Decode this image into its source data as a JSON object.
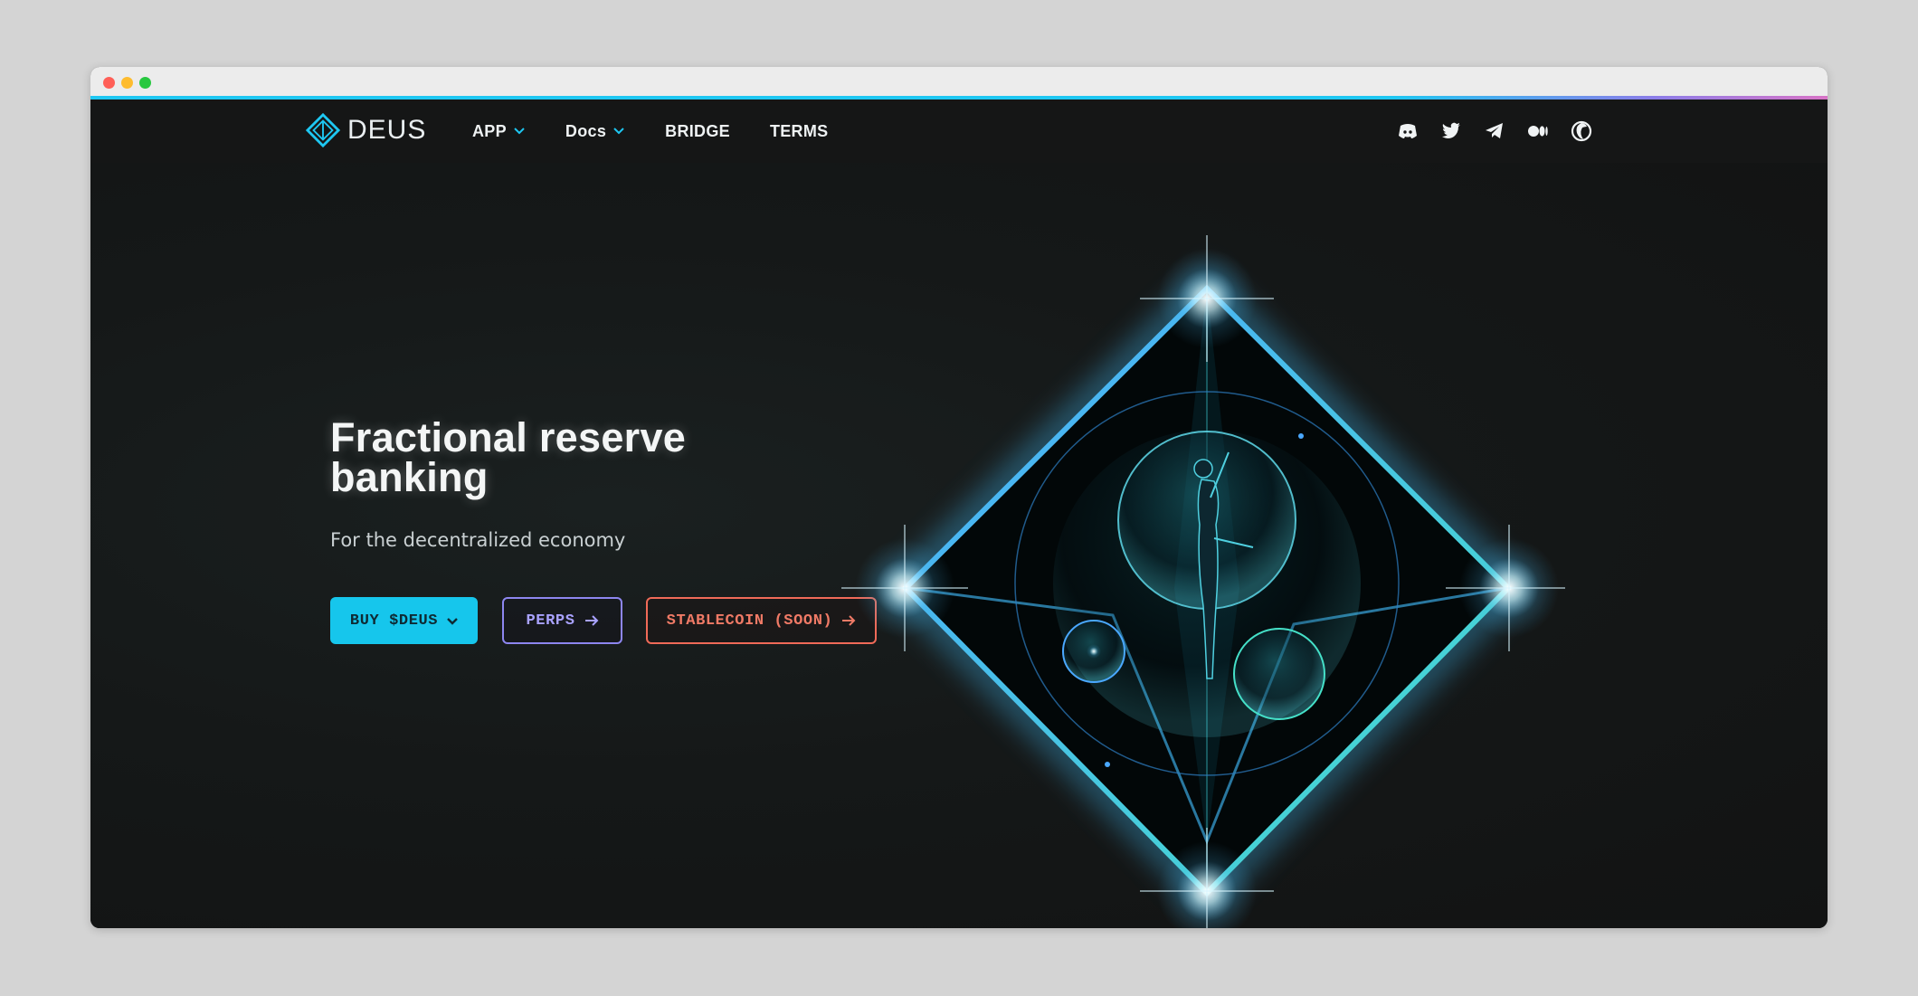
{
  "brand": {
    "name": "DEUS",
    "accent": "#16c6ec"
  },
  "nav": {
    "items": [
      {
        "label": "APP",
        "has_dropdown": true
      },
      {
        "label": "Docs",
        "has_dropdown": true
      },
      {
        "label": "BRIDGE",
        "has_dropdown": false
      },
      {
        "label": "TERMS",
        "has_dropdown": false
      }
    ],
    "socials": [
      "discord-icon",
      "twitter-icon",
      "telegram-icon",
      "medium-icon",
      "coingecko-icon"
    ]
  },
  "hero": {
    "title": "Fractional reserve banking",
    "subtitle": "For the decentralized economy",
    "buttons": {
      "buy": "BUY $DEUS",
      "perps": "PERPS",
      "stablecoin": "STABLECOIN (SOON)"
    }
  }
}
